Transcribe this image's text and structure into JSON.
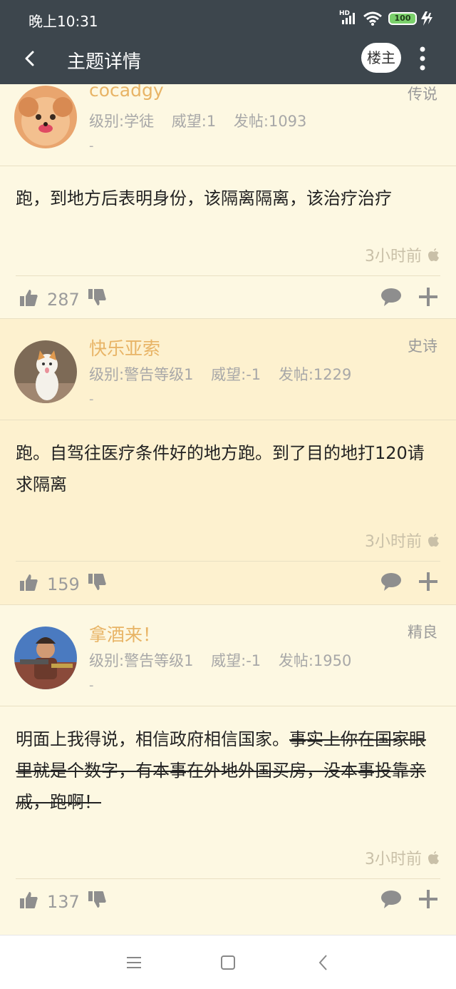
{
  "status_bar": {
    "time": "晚上10:31",
    "network_badge": "HD",
    "battery": "100"
  },
  "app_bar": {
    "title": "主题详情",
    "owner_button": "楼主"
  },
  "posts": [
    {
      "username": "cocadgy",
      "rank": "传说",
      "meta": {
        "level": "级别:学徒",
        "reputation": "威望:1",
        "posts": "发帖:1093"
      },
      "signature": "-",
      "content": "跑，到地方后表明身份，该隔离隔离，该治疗治疗",
      "time": "3小时前",
      "likes": "287"
    },
    {
      "username": "快乐亚索",
      "rank": "史诗",
      "meta": {
        "level": "级别:警告等级1",
        "reputation": "威望:-1",
        "posts": "发帖:1229"
      },
      "signature": "-",
      "content": "跑。自驾往医疗条件好的地方跑。到了目的地打120请求隔离",
      "time": "3小时前",
      "likes": "159"
    },
    {
      "username": "拿酒来！",
      "rank": "精良",
      "meta": {
        "level": "级别:警告等级1",
        "reputation": "威望:-1",
        "posts": "发帖:1950"
      },
      "signature": "-",
      "content_plain": "明面上我得说，相信政府相信国家。",
      "content_struck": "事实上你在国家眼里就是个数字，有本事在外地外国买房，没本事投靠亲戚，跑啊！",
      "time": "3小时前",
      "likes": "137"
    }
  ],
  "colors": {
    "header_bg": "#3d464d",
    "username": "#e8b466",
    "page_bg": "#fdf8e2",
    "highlight_bg": "#fdf1cf",
    "icon": "#8e8e8e"
  }
}
